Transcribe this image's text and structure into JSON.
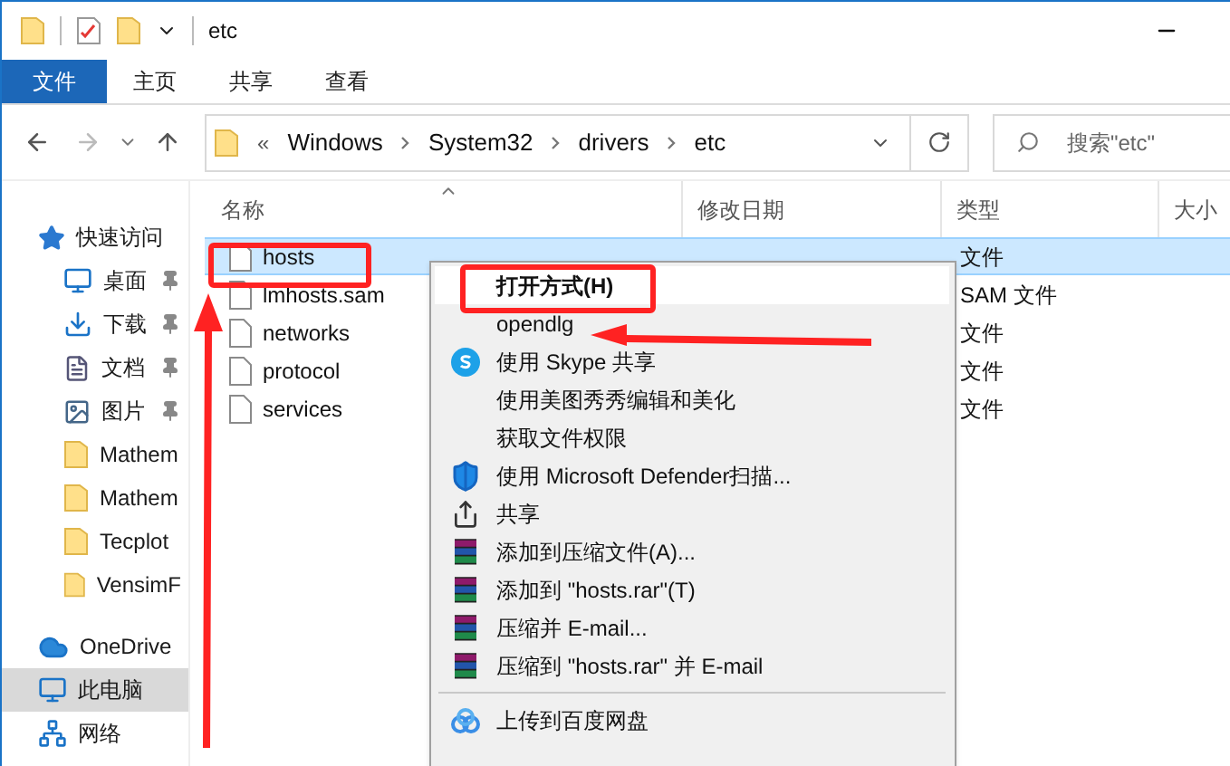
{
  "title_bar": {
    "title": "etc"
  },
  "ribbon_tabs": [
    {
      "label": "文件",
      "selected": true
    },
    {
      "label": "主页",
      "selected": false
    },
    {
      "label": "共享",
      "selected": false
    },
    {
      "label": "查看",
      "selected": false
    }
  ],
  "address_bar": {
    "overflow": "«",
    "crumbs": [
      "Windows",
      "System32",
      "drivers",
      "etc"
    ]
  },
  "search": {
    "placeholder": "搜索\"etc\""
  },
  "sidebar": {
    "items": [
      {
        "label": "快速访问",
        "kind": "star",
        "pinned": false,
        "selected": false,
        "children": [
          {
            "label": "桌面",
            "kind": "desktop",
            "pinned": true,
            "selected": false
          },
          {
            "label": "下载",
            "kind": "download",
            "pinned": true,
            "selected": false
          },
          {
            "label": "文档",
            "kind": "document",
            "pinned": true,
            "selected": false
          },
          {
            "label": "图片",
            "kind": "picture",
            "pinned": true,
            "selected": false
          },
          {
            "label": "Mathem",
            "kind": "folder",
            "pinned": false,
            "selected": false
          },
          {
            "label": "Mathem",
            "kind": "folder",
            "pinned": false,
            "selected": false
          },
          {
            "label": "Tecplot",
            "kind": "folder",
            "pinned": false,
            "selected": false
          },
          {
            "label": "VensimF",
            "kind": "folder",
            "pinned": false,
            "selected": false
          }
        ]
      },
      {
        "label": "OneDrive",
        "kind": "cloud",
        "pinned": false,
        "selected": false
      },
      {
        "label": "此电脑",
        "kind": "pc",
        "pinned": false,
        "selected": true
      },
      {
        "label": "网络",
        "kind": "network",
        "pinned": false,
        "selected": false
      }
    ]
  },
  "table": {
    "columns": [
      "名称",
      "修改日期",
      "类型",
      "大小"
    ],
    "rows": [
      {
        "name": "hosts",
        "type": "文件",
        "selected": true
      },
      {
        "name": "lmhosts.sam",
        "type": "SAM 文件",
        "selected": false
      },
      {
        "name": "networks",
        "type": "文件",
        "selected": false
      },
      {
        "name": "protocol",
        "type": "文件",
        "selected": false
      },
      {
        "name": "services",
        "type": "文件",
        "selected": false
      }
    ]
  },
  "context_menu": {
    "items": [
      {
        "kind": "default",
        "label": "打开方式(H)",
        "selected": true
      },
      {
        "kind": "plain",
        "label": "opendlg",
        "selected": false
      },
      {
        "kind": "skype",
        "label": "使用 Skype 共享",
        "selected": false
      },
      {
        "kind": "plain",
        "label": "使用美图秀秀编辑和美化",
        "selected": false
      },
      {
        "kind": "plain",
        "label": "获取文件权限",
        "selected": false
      },
      {
        "kind": "shield",
        "label": "使用 Microsoft Defender扫描...",
        "selected": false
      },
      {
        "kind": "share",
        "label": "共享",
        "selected": false
      },
      {
        "kind": "archive",
        "label": "添加到压缩文件(A)...",
        "selected": false
      },
      {
        "kind": "archive",
        "label": "添加到 \"hosts.rar\"(T)",
        "selected": false
      },
      {
        "kind": "archive",
        "label": "压缩并 E-mail...",
        "selected": false
      },
      {
        "kind": "archive",
        "label": "压缩到 \"hosts.rar\" 并 E-mail",
        "selected": false
      },
      {
        "kind": "separator"
      },
      {
        "kind": "cloud",
        "label": "上传到百度网盘",
        "selected": false
      }
    ]
  }
}
